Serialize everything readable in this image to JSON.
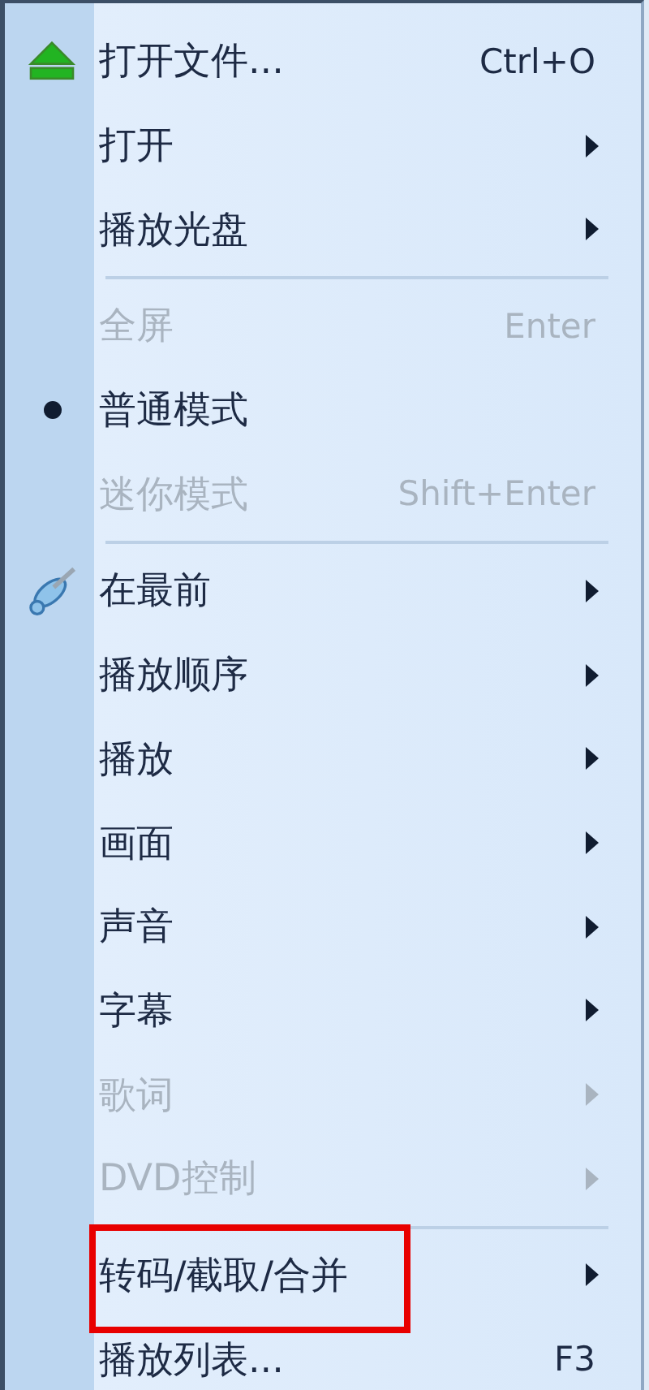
{
  "menu": {
    "items": [
      {
        "kind": "item",
        "label": "打开文件...",
        "shortcut": "Ctrl+O",
        "submenu": false,
        "disabled": false,
        "checked": false,
        "highlighted": false
      },
      {
        "kind": "item",
        "label": "打开",
        "submenu": true,
        "disabled": false,
        "checked": false,
        "highlighted": false
      },
      {
        "kind": "item",
        "label": "播放光盘",
        "submenu": true,
        "disabled": false,
        "checked": false,
        "highlighted": false
      },
      {
        "kind": "separator"
      },
      {
        "kind": "item",
        "label": "全屏",
        "shortcut": "Enter",
        "submenu": false,
        "disabled": true,
        "checked": false,
        "highlighted": false
      },
      {
        "kind": "item",
        "label": "普通模式",
        "submenu": false,
        "disabled": false,
        "checked": true,
        "highlighted": false
      },
      {
        "kind": "item",
        "label": "迷你模式",
        "shortcut": "Shift+Enter",
        "submenu": false,
        "disabled": true,
        "checked": false,
        "highlighted": false
      },
      {
        "kind": "separator"
      },
      {
        "kind": "item",
        "label": "在最前",
        "submenu": true,
        "disabled": false,
        "checked": false,
        "highlighted": false
      },
      {
        "kind": "item",
        "label": "播放顺序",
        "submenu": true,
        "disabled": false,
        "checked": false,
        "highlighted": false
      },
      {
        "kind": "item",
        "label": "播放",
        "submenu": true,
        "disabled": false,
        "checked": false,
        "highlighted": false
      },
      {
        "kind": "item",
        "label": "画面",
        "submenu": true,
        "disabled": false,
        "checked": false,
        "highlighted": false
      },
      {
        "kind": "item",
        "label": "声音",
        "submenu": true,
        "disabled": false,
        "checked": false,
        "highlighted": false
      },
      {
        "kind": "item",
        "label": "字幕",
        "submenu": true,
        "disabled": false,
        "checked": false,
        "highlighted": false
      },
      {
        "kind": "item",
        "label": "歌词",
        "submenu": true,
        "disabled": true,
        "checked": false,
        "highlighted": false
      },
      {
        "kind": "item",
        "label": "DVD控制",
        "submenu": true,
        "disabled": true,
        "checked": false,
        "highlighted": false
      },
      {
        "kind": "separator"
      },
      {
        "kind": "item",
        "label": "转码/截取/合并",
        "submenu": true,
        "disabled": false,
        "checked": false,
        "highlighted": true
      },
      {
        "kind": "item",
        "label": "播放列表...",
        "shortcut": "F3",
        "submenu": false,
        "disabled": false,
        "checked": false,
        "highlighted": false
      }
    ]
  }
}
